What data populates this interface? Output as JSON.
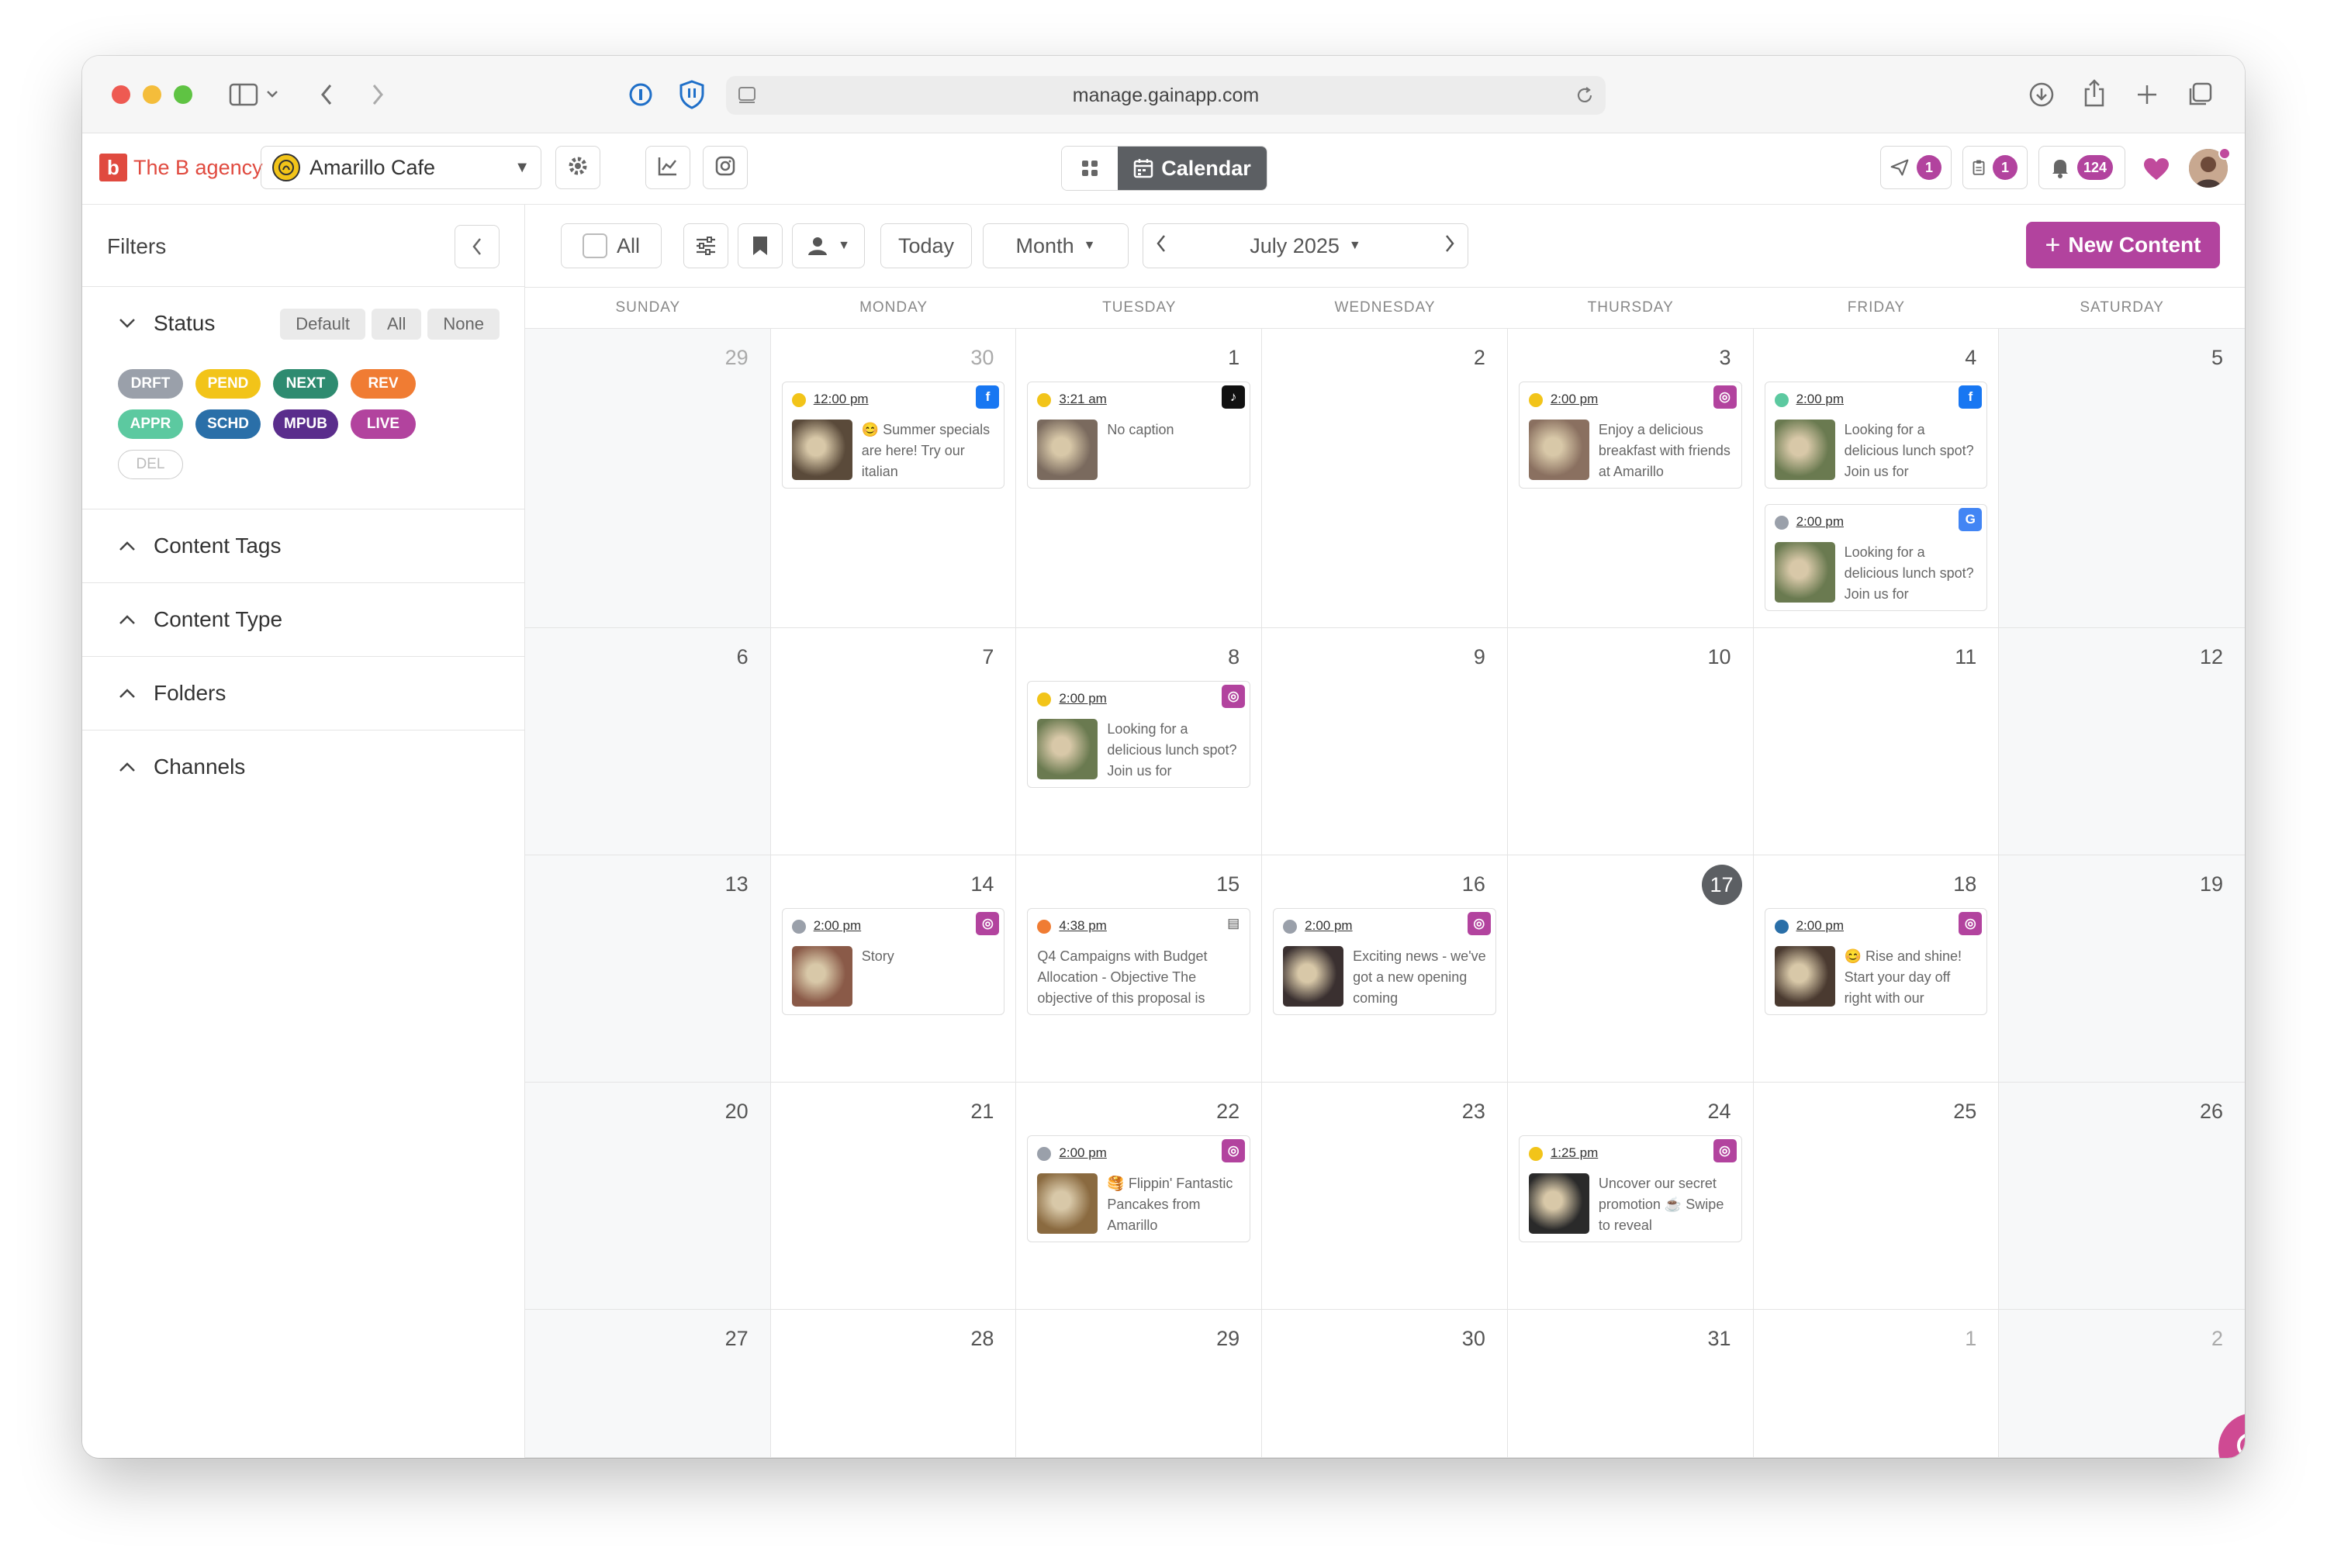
{
  "browser": {
    "url": "manage.gainapp.com"
  },
  "header": {
    "brand": "The B agency",
    "brand_letter": "b",
    "account": "Amarillo Cafe",
    "view_calendar": "Calendar",
    "send_count": "1",
    "tasks_count": "1",
    "notif_count": "124"
  },
  "sidebar": {
    "title": "Filters",
    "status": {
      "label": "Status",
      "buttons": [
        "Default",
        "All",
        "None"
      ],
      "chips": [
        {
          "label": "DRFT",
          "color": "#9aa0aa"
        },
        {
          "label": "PEND",
          "color": "#f2c419"
        },
        {
          "label": "NEXT",
          "color": "#2e8b70"
        },
        {
          "label": "REV",
          "color": "#f07c33"
        },
        {
          "label": "APPR",
          "color": "#5cc9a0"
        },
        {
          "label": "SCHD",
          "color": "#2a6fa8"
        },
        {
          "label": "MPUB",
          "color": "#5a2d8c"
        },
        {
          "label": "LIVE",
          "color": "#b2439e"
        },
        {
          "label": "DEL",
          "color": "#ffffff"
        }
      ]
    },
    "sections": [
      "Content Tags",
      "Content Type",
      "Folders",
      "Channels"
    ]
  },
  "controls": {
    "all": "All",
    "today": "Today",
    "view": "Month",
    "period": "July 2025",
    "new_content": "New Content"
  },
  "weekdays": [
    "SUNDAY",
    "MONDAY",
    "TUESDAY",
    "WEDNESDAY",
    "THURSDAY",
    "FRIDAY",
    "SATURDAY"
  ],
  "days": [
    "29",
    "30",
    "1",
    "2",
    "3",
    "4",
    "5",
    "6",
    "7",
    "8",
    "9",
    "10",
    "11",
    "12",
    "13",
    "14",
    "15",
    "16",
    "17",
    "18",
    "19",
    "20",
    "21",
    "22",
    "23",
    "24",
    "25",
    "26",
    "27",
    "28",
    "29",
    "30",
    "31",
    "1",
    "2"
  ],
  "posts": [
    {
      "time": "12:00 pm",
      "caption": "😊 Summer specials are here! Try our italian",
      "status_color": "#f2c419",
      "network": "facebook"
    },
    {
      "time": "3:21 am",
      "caption": "No caption",
      "status_color": "#f2c419",
      "network": "tiktok"
    },
    {
      "time": "2:00 pm",
      "caption": "Enjoy a delicious breakfast with friends at Amarillo",
      "status_color": "#f2c419",
      "network": "instagram"
    },
    {
      "time": "2:00 pm",
      "caption": "Looking for a delicious lunch spot? Join us for",
      "status_color": "#5cc9a0",
      "network": "facebook"
    },
    {
      "time": "2:00 pm",
      "caption": "Looking for a delicious lunch spot? Join us for",
      "status_color": "#9aa0aa",
      "network": "google"
    },
    {
      "time": "2:00 pm",
      "caption": "Looking for a delicious lunch spot? Join us for",
      "status_color": "#f2c419",
      "network": "instagram"
    },
    {
      "time": "2:00 pm",
      "caption": "Story",
      "status_color": "#9aa0aa",
      "network": "instagram"
    },
    {
      "time": "4:38 pm",
      "caption": "Q4 Campaigns with Budget Allocation - Objective The objective of this proposal is",
      "status_color": "#f07c33",
      "network": "document"
    },
    {
      "time": "2:00 pm",
      "caption": "Exciting news - we've got a new opening coming",
      "status_color": "#9aa0aa",
      "network": "instagram"
    },
    {
      "time": "2:00 pm",
      "caption": "😊 Rise and shine! Start your day off right with our",
      "status_color": "#2a6fa8",
      "network": "instagram"
    },
    {
      "time": "2:00 pm",
      "caption": "🥞 Flippin' Fantastic Pancakes from Amarillo",
      "status_color": "#9aa0aa",
      "network": "instagram"
    },
    {
      "time": "1:25 pm",
      "caption": "Uncover our secret promotion ☕ Swipe to reveal",
      "status_color": "#f2c419",
      "network": "instagram"
    }
  ]
}
